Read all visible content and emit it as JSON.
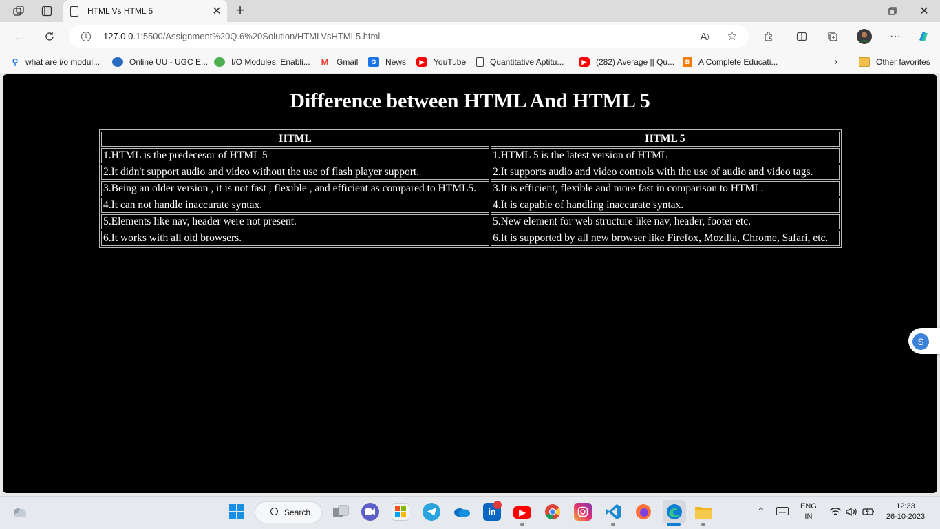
{
  "browser": {
    "tab_title": "HTML Vs HTML 5",
    "url_host": "127.0.0.1",
    "url_rest": ":5500/Assignment%20Q.6%20Solution/HTMLVsHTML5.html"
  },
  "favorites": [
    {
      "label": "what are i/o modul...",
      "icon": "search-icon",
      "color": "#1a73e8"
    },
    {
      "label": "Online UU - UGC E...",
      "icon": "site-logo-icon",
      "color": "#2a6bc2"
    },
    {
      "label": "I/O Modules: Enabli...",
      "icon": "leaf-logo-icon",
      "color": "#4caf50"
    },
    {
      "label": "Gmail",
      "icon": "gmail-icon",
      "color": "#ea4335"
    },
    {
      "label": "News",
      "icon": "news-icon",
      "color": "#1a73e8"
    },
    {
      "label": "YouTube",
      "icon": "youtube-icon",
      "color": "#ff0000"
    },
    {
      "label": "Quantitative Aptitu...",
      "icon": "document-icon",
      "color": "#444444"
    },
    {
      "label": "(282) Average || Qu...",
      "icon": "youtube-icon",
      "color": "#ff0000"
    },
    {
      "label": "A Complete Educati...",
      "icon": "blogger-icon",
      "color": "#f57c00"
    },
    {
      "label": "Other favorites",
      "icon": "folder-icon",
      "color": "#f2c04c"
    }
  ],
  "page": {
    "heading": "Difference between HTML And HTML 5",
    "table": {
      "headers": [
        "HTML",
        "HTML 5"
      ],
      "rows": [
        [
          "1.HTML is the predecesor of HTML 5",
          "1.HTML 5 is the latest version of HTML"
        ],
        [
          "2.It didn't support audio and video without the use of flash player support.",
          "2.It supports audio and video controls with the use of audio and video tags."
        ],
        [
          "3.Being an older version , it is not fast , flexible , and efficient as compared to HTML5.",
          "3.It is efficient, flexible and more fast in comparison to HTML."
        ],
        [
          "4.It can not handle inaccurate syntax.",
          "4.It is capable of handling inaccurate syntax."
        ],
        [
          "5.Elements like nav, header were not present.",
          "5.New element for web structure like nav, header, footer etc."
        ],
        [
          "6.It works with all old browsers.",
          "6.It is supported by all new browser like Firefox, Mozilla, Chrome, Safari, etc."
        ]
      ]
    }
  },
  "taskbar": {
    "search_label": "Search",
    "lang_top": "ENG",
    "lang_bottom": "IN",
    "time": "12:33",
    "date": "26-10-2023",
    "apps": [
      "start-icon",
      "search",
      "task-view-icon",
      "teams-icon",
      "store-icon",
      "telegram-icon",
      "onedrive-icon",
      "linkedin-icon",
      "youtube-icon",
      "chrome-icon",
      "instagram-icon",
      "vscode-icon",
      "firefox-icon",
      "edge-icon",
      "file-explorer-icon"
    ]
  },
  "colors": {
    "page_bg": "#000000",
    "text": "#ffffff",
    "border": "#bbbbbb",
    "chrome_bg": "#f7f7f7"
  }
}
